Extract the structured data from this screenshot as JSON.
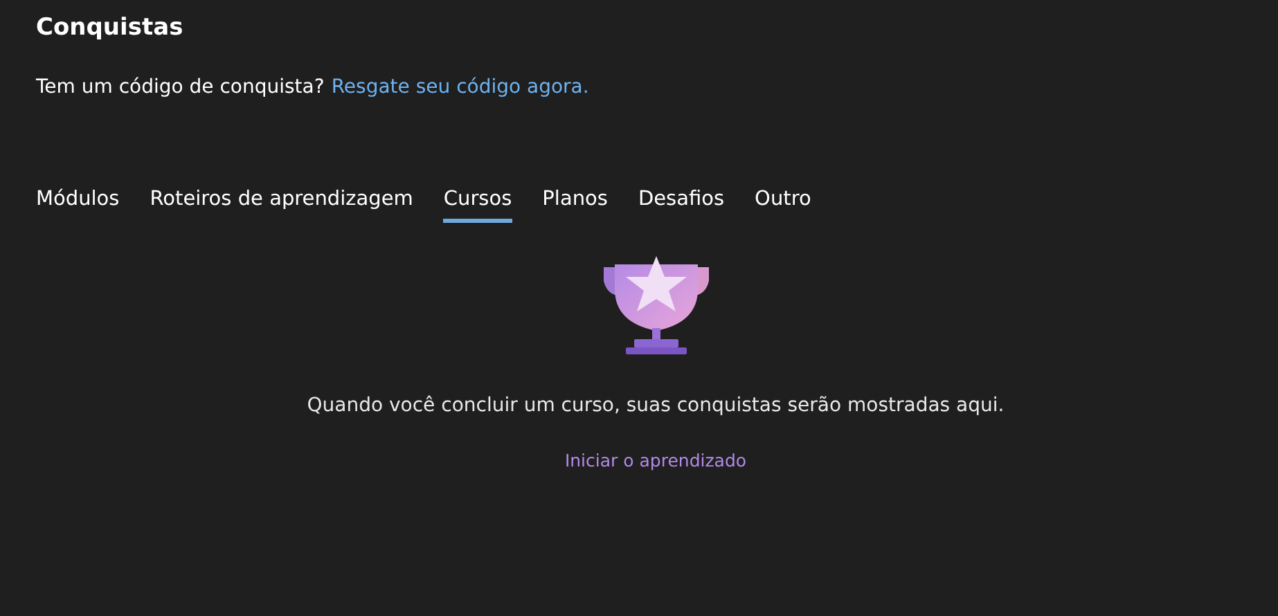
{
  "title": "Conquistas",
  "redeem": {
    "prompt": "Tem um código de conquista?",
    "link": "Resgate seu código agora."
  },
  "tabs": [
    {
      "label": "Módulos",
      "selected": false
    },
    {
      "label": "Roteiros de aprendizagem",
      "selected": false
    },
    {
      "label": "Cursos",
      "selected": true
    },
    {
      "label": "Planos",
      "selected": false
    },
    {
      "label": "Desafios",
      "selected": false
    },
    {
      "label": "Outro",
      "selected": false
    }
  ],
  "empty_state": {
    "message": "Quando você concluir um curso, suas conquistas serão mostradas aqui.",
    "link": "Iniciar o aprendizado"
  }
}
